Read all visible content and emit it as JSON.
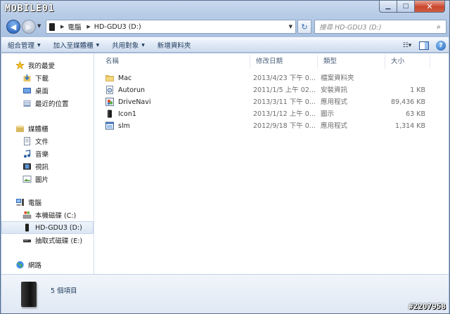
{
  "watermark": "MOBILE01",
  "address": {
    "crumbs": [
      "電腦",
      "HD-GDU3 (D:)"
    ]
  },
  "search": {
    "placeholder": "搜尋 HD-GDU3 (D:)"
  },
  "toolbar": {
    "organize": "組合管理",
    "add_to_library": "加入至媒體櫃",
    "share_with": "共用對象",
    "new_folder": "新增資料夾"
  },
  "sidebar": {
    "favorites": {
      "label": "我的最愛",
      "items": [
        "下載",
        "桌面",
        "最近的位置"
      ]
    },
    "libraries": {
      "label": "媒體櫃",
      "items": [
        "文件",
        "音樂",
        "視訊",
        "圖片"
      ]
    },
    "computer": {
      "label": "電腦",
      "items": [
        "本機磁碟 (C:)",
        "HD-GDU3 (D:)",
        "抽取式磁碟 (E:)"
      ]
    },
    "network": {
      "label": "網路"
    }
  },
  "columns": {
    "name": "名稱",
    "date": "修改日期",
    "type": "類型",
    "size": "大小"
  },
  "files": [
    {
      "name": "Mac",
      "date": "2013/4/23 下午 0...",
      "type": "檔案資料夾",
      "size": "",
      "icon": "folder-icon"
    },
    {
      "name": "Autorun",
      "date": "2011/1/5 上午 02...",
      "type": "安裝資訊",
      "size": "1 KB",
      "icon": "settings-file-icon"
    },
    {
      "name": "DriveNavi",
      "date": "2013/3/11 下午 0...",
      "type": "應用程式",
      "size": "89,436 KB",
      "icon": "application-icon"
    },
    {
      "name": "Icon1",
      "date": "2013/1/12 上午 0...",
      "type": "圖示",
      "size": "63 KB",
      "icon": "drive-icon"
    },
    {
      "name": "slm",
      "date": "2012/9/18 下午 0...",
      "type": "應用程式",
      "size": "1,314 KB",
      "icon": "app-window-icon"
    }
  ],
  "status": {
    "count": "5 個項目"
  },
  "badge": "#2207958",
  "colors": {
    "accent": "#1e395b",
    "selection": "#dbe6f4",
    "close": "#c9462c"
  }
}
